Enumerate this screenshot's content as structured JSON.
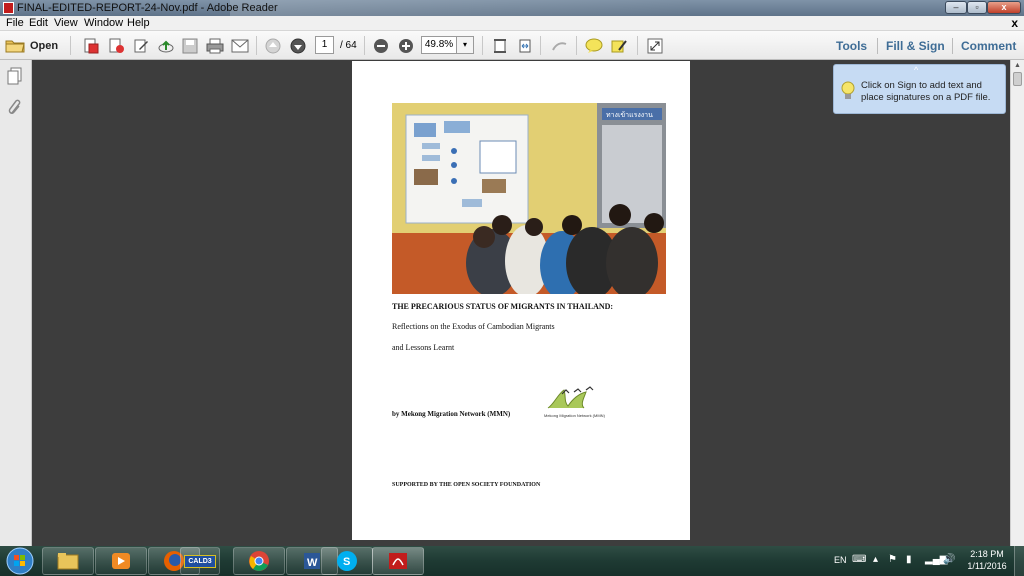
{
  "window": {
    "title": "FINAL-EDITED-REPORT-24-Nov.pdf - Adobe Reader",
    "minimize_glyph": "–",
    "maximize_glyph": "▫",
    "close_glyph": "x"
  },
  "menubar": {
    "items": [
      "File",
      "Edit",
      "View",
      "Window",
      "Help"
    ],
    "doc_close": "x"
  },
  "toolbar": {
    "open_label": "Open",
    "page_current": "1",
    "page_total": "/ 64",
    "zoom_value": "49.8%",
    "zoom_arrow": "▾",
    "links": [
      "Tools",
      "Fill & Sign",
      "Comment"
    ]
  },
  "document": {
    "title": "THE PRECARIOUS STATUS OF MIGRANTS IN THAILAND:",
    "subtitle_line1": "Reflections on the Exodus of Cambodian Migrants",
    "subtitle_line2": "and Lessons Learnt",
    "author": "by Mekong Migration Network (MMN)",
    "logo_caption": "Mekong Migration Network (MMN)",
    "support": "SUPPORTED BY THE OPEN SOCIETY FOUNDATION",
    "photo_sign_text": "ทางเข้าแรงงาน"
  },
  "tooltip": {
    "text": "Click on Sign to add text and place signatures on a PDF file.",
    "arrow": "^"
  },
  "taskbar": {
    "apps": [
      "file-explorer",
      "media-player",
      "firefox",
      "cald3",
      "chrome",
      "word",
      "skype",
      "acrobat-reader"
    ],
    "cald3_label": "CALD3",
    "tray_lang": "EN",
    "tray_arrow": "▴",
    "time": "2:18 PM",
    "date": "1/11/2016"
  },
  "colors": {
    "accent_link": "#3f6d96",
    "taskbar": "#1e3a33",
    "tooltip_bg": "#c6dbf3"
  }
}
